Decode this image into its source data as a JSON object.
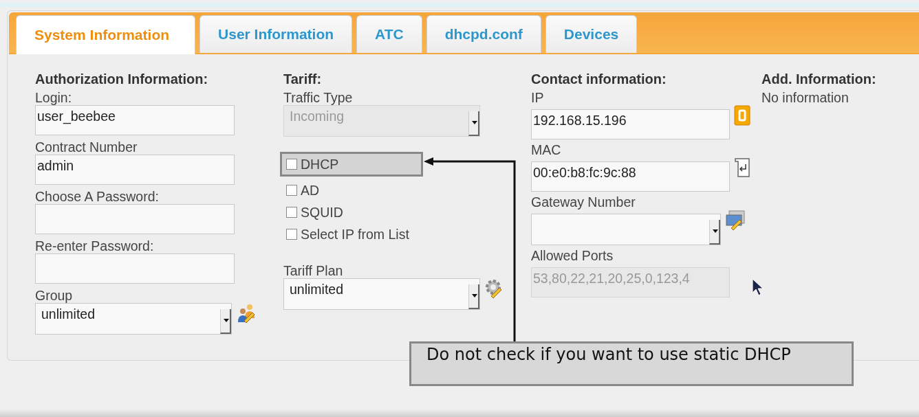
{
  "tabs": [
    {
      "label": "System Information",
      "selected": true
    },
    {
      "label": "User Information",
      "selected": false
    },
    {
      "label": "ATC",
      "selected": false
    },
    {
      "label": "dhcpd.conf",
      "selected": false
    },
    {
      "label": "Devices",
      "selected": false
    }
  ],
  "authorization": {
    "title": "Authorization Information:",
    "fields": [
      {
        "kind": "text",
        "label": "Login:",
        "value": "user_beebee",
        "disabled": false
      },
      {
        "kind": "text",
        "label": "Contract Number",
        "value": "admin",
        "disabled": false
      },
      {
        "kind": "text",
        "label": "Choose A Password:",
        "disabled": false
      },
      {
        "kind": "text",
        "label": "Re-enter Password:",
        "disabled": false
      },
      {
        "kind": "select",
        "label": "Group",
        "value": "unlimited",
        "disabled": false
      }
    ]
  },
  "tariff": {
    "title": "Tariff:",
    "traffic_type": {
      "kind": "select",
      "label": "Traffic Type",
      "value": "Incoming",
      "disabled": true
    },
    "options": [
      {
        "label": "DHCP",
        "checked": false,
        "highlighted": true
      },
      {
        "label": "AD",
        "checked": false,
        "highlighted": false
      },
      {
        "label": "SQUID",
        "checked": false,
        "highlighted": false
      },
      {
        "label": "Select IP from List",
        "checked": false,
        "highlighted": false
      }
    ],
    "tariff_plan": {
      "kind": "select",
      "label": "Tariff Plan",
      "value": "unlimited",
      "disabled": false
    }
  },
  "contact": {
    "title": "Contact information:",
    "fields": [
      {
        "kind": "text",
        "label": "IP",
        "value": "192.168.15.196",
        "disabled": false
      },
      {
        "kind": "text",
        "label": "MAC",
        "value": "00:e0:b8:fc:9c:88",
        "disabled": false
      },
      {
        "kind": "select",
        "label": "Gateway Number",
        "disabled": false
      },
      {
        "kind": "text",
        "label": "Allowed Ports",
        "value": "53,80,22,21,20,25,0,123,4",
        "disabled": true
      }
    ]
  },
  "additional": {
    "title": "Add. Information:",
    "text": "No information"
  },
  "callout": {
    "text": "Do not check if you want to use static DHCP"
  }
}
